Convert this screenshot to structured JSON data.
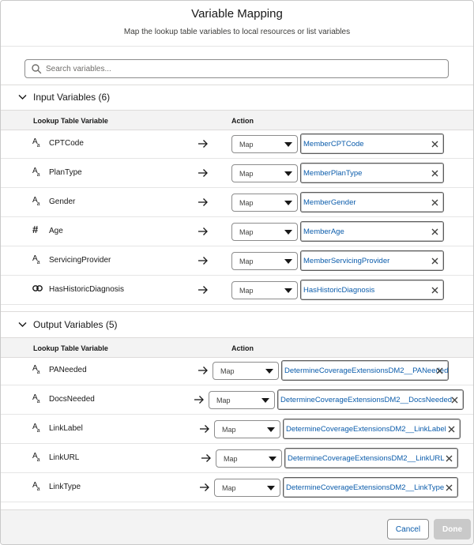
{
  "modal": {
    "title": "Variable Mapping",
    "subtitle": "Map the lookup table variables to local resources or list variables"
  },
  "search": {
    "placeholder": "Search variables..."
  },
  "input_section": {
    "title": "Input Variables (6)",
    "col_variable": "Lookup Table Variable",
    "col_action": "Action",
    "rows": [
      {
        "icon": "text-type-icon",
        "name": "CPTCode",
        "action": "Map",
        "value": "MemberCPTCode"
      },
      {
        "icon": "text-type-icon",
        "name": "PlanType",
        "action": "Map",
        "value": "MemberPlanType"
      },
      {
        "icon": "text-type-icon",
        "name": "Gender",
        "action": "Map",
        "value": "MemberGender"
      },
      {
        "icon": "number-type-icon",
        "name": "Age",
        "action": "Map",
        "value": "MemberAge"
      },
      {
        "icon": "text-type-icon",
        "name": "ServicingProvider",
        "action": "Map",
        "value": "MemberServicingProvider"
      },
      {
        "icon": "boolean-type-icon",
        "name": "HasHistoricDiagnosis",
        "action": "Map",
        "value": "HasHistoricDiagnosis"
      }
    ]
  },
  "output_section": {
    "title": "Output Variables (5)",
    "col_variable": "Lookup Table Variable",
    "col_action": "Action",
    "rows": [
      {
        "icon": "text-type-icon",
        "name": "PANeeded",
        "action": "Map",
        "value": "DetermineCoverageExtensionsDM2__PANeeded"
      },
      {
        "icon": "text-type-icon",
        "name": "DocsNeeded",
        "action": "Map",
        "value": "DetermineCoverageExtensionsDM2__DocsNeeded"
      },
      {
        "icon": "text-type-icon",
        "name": "LinkLabel",
        "action": "Map",
        "value": "DetermineCoverageExtensionsDM2__LinkLabel"
      },
      {
        "icon": "text-type-icon",
        "name": "LinkURL",
        "action": "Map",
        "value": "DetermineCoverageExtensionsDM2__LinkURL"
      },
      {
        "icon": "text-type-icon",
        "name": "LinkType",
        "action": "Map",
        "value": "DetermineCoverageExtensionsDM2__LinkType"
      }
    ]
  },
  "footer": {
    "cancel_label": "Cancel",
    "done_label": "Done"
  },
  "colors": {
    "link": "#0b5cab",
    "border": "#8c8c8c",
    "header_bg": "#f3f3f3",
    "done_disabled": "#c9c9c9"
  }
}
